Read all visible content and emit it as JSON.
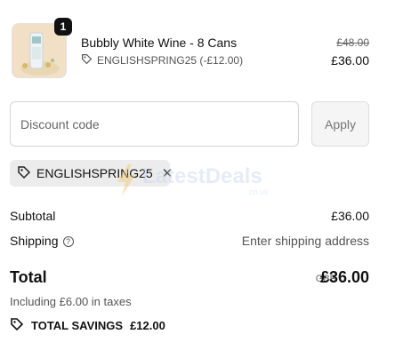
{
  "cart_item": {
    "quantity": "1",
    "title": "Bubbly White Wine - 8 Cans",
    "discount_code": "ENGLISHSPRING25 (-£12.00)",
    "original_price": "£48.00",
    "price": "£36.00"
  },
  "discount": {
    "placeholder": "Discount code",
    "apply_label": "Apply",
    "applied_code": "ENGLISHSPRING25"
  },
  "watermark": {
    "text": "LatestDeals",
    "sub": "co.uk"
  },
  "summary": {
    "subtotal_label": "Subtotal",
    "subtotal_value": "£36.00",
    "shipping_label": "Shipping",
    "shipping_value": "Enter shipping address",
    "total_label": "Total",
    "currency": "GBP",
    "total_value": "£36.00",
    "taxes_note": "Including £6.00 in taxes",
    "savings_label": "TOTAL SAVINGS",
    "savings_value": "£12.00"
  },
  "colors": {
    "text": "#111111",
    "muted": "#555555",
    "chip_bg": "#ececec",
    "apply_bg": "#f5f5f5"
  }
}
